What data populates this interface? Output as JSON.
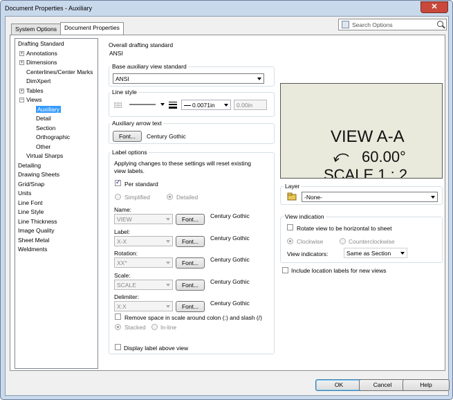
{
  "window": {
    "title": "Document Properties - Auxiliary",
    "close": "✕"
  },
  "tabs": [
    "System Options",
    "Document Properties"
  ],
  "search": {
    "placeholder": "Search Options"
  },
  "tree": [
    {
      "label": "Drafting Standard",
      "level": 0,
      "exp": ""
    },
    {
      "label": "Annotations",
      "level": 1,
      "exp": "+"
    },
    {
      "label": "Dimensions",
      "level": 1,
      "exp": "+"
    },
    {
      "label": "Centerlines/Center Marks",
      "level": 1,
      "exp": ""
    },
    {
      "label": "DimXpert",
      "level": 1,
      "exp": ""
    },
    {
      "label": "Tables",
      "level": 1,
      "exp": "+"
    },
    {
      "label": "Views",
      "level": 1,
      "exp": "−"
    },
    {
      "label": "Auxiliary",
      "level": 2,
      "exp": "",
      "sel": true
    },
    {
      "label": "Detail",
      "level": 2,
      "exp": ""
    },
    {
      "label": "Section",
      "level": 2,
      "exp": ""
    },
    {
      "label": "Orthographic",
      "level": 2,
      "exp": ""
    },
    {
      "label": "Other",
      "level": 2,
      "exp": ""
    },
    {
      "label": "Virtual Sharps",
      "level": 1,
      "exp": ""
    },
    {
      "label": "Detailing",
      "level": 0,
      "exp": ""
    },
    {
      "label": "Drawing Sheets",
      "level": 0,
      "exp": ""
    },
    {
      "label": "Grid/Snap",
      "level": 0,
      "exp": ""
    },
    {
      "label": "Units",
      "level": 0,
      "exp": ""
    },
    {
      "label": "Line Font",
      "level": 0,
      "exp": ""
    },
    {
      "label": "Line Style",
      "level": 0,
      "exp": ""
    },
    {
      "label": "Line Thickness",
      "level": 0,
      "exp": ""
    },
    {
      "label": "Image Quality",
      "level": 0,
      "exp": ""
    },
    {
      "label": "Sheet Metal",
      "level": 0,
      "exp": ""
    },
    {
      "label": "Weldments",
      "level": 0,
      "exp": ""
    }
  ],
  "overall": {
    "label": "Overall drafting standard",
    "value": "ANSI"
  },
  "base_std": {
    "label": "Base auxiliary view standard",
    "value": "ANSI"
  },
  "line_style": {
    "label": "Line style",
    "thickness": "0.0071in",
    "custom": "0.00in"
  },
  "arrow_text": {
    "label": "Auxiliary arrow text",
    "font_btn": "Font...",
    "font_name": "Century Gothic"
  },
  "label_options": {
    "label": "Label options",
    "note": "Applying changes to these settings will reset existing view labels.",
    "per_standard": "Per standard",
    "simplified": "Simplified",
    "detailed": "Detailed",
    "rows": [
      {
        "label": "Name:",
        "value": "VIEW",
        "font_btn": "Font...",
        "font": "Century Gothic"
      },
      {
        "label": "Label:",
        "value": "X-X",
        "font_btn": "Font...",
        "font": "Century Gothic"
      },
      {
        "label": "Rotation:",
        "value": "XX°",
        "font_btn": "Font...",
        "font": "Century Gothic"
      },
      {
        "label": "Scale:",
        "value": "SCALE",
        "font_btn": "Font...",
        "font": "Century Gothic"
      },
      {
        "label": "Delimiter:",
        "value": "X:X",
        "font_btn": "Font...",
        "font": "Century Gothic"
      }
    ],
    "remove_space": "Remove space in scale around colon (:) and slash (/)",
    "stacked": "Stacked",
    "inline": "In-line"
  },
  "display_above": "Display label above view",
  "preview": {
    "line1": "VIEW A-A",
    "line2": "60.00°",
    "line3": "SCALE 1 : 2"
  },
  "layer": {
    "label": "Layer",
    "value": "-None-"
  },
  "view_indication": {
    "label": "View indication",
    "rotate": "Rotate view to be horizontal to sheet",
    "clockwise": "Clockwise",
    "counterclockwise": "Counterclockwise",
    "indicators_label": "View indicators:",
    "indicators_value": "Same as Section"
  },
  "include_location": "Include location labels for new views",
  "buttons": {
    "ok": "OK",
    "cancel": "Cancel",
    "help": "Help"
  }
}
